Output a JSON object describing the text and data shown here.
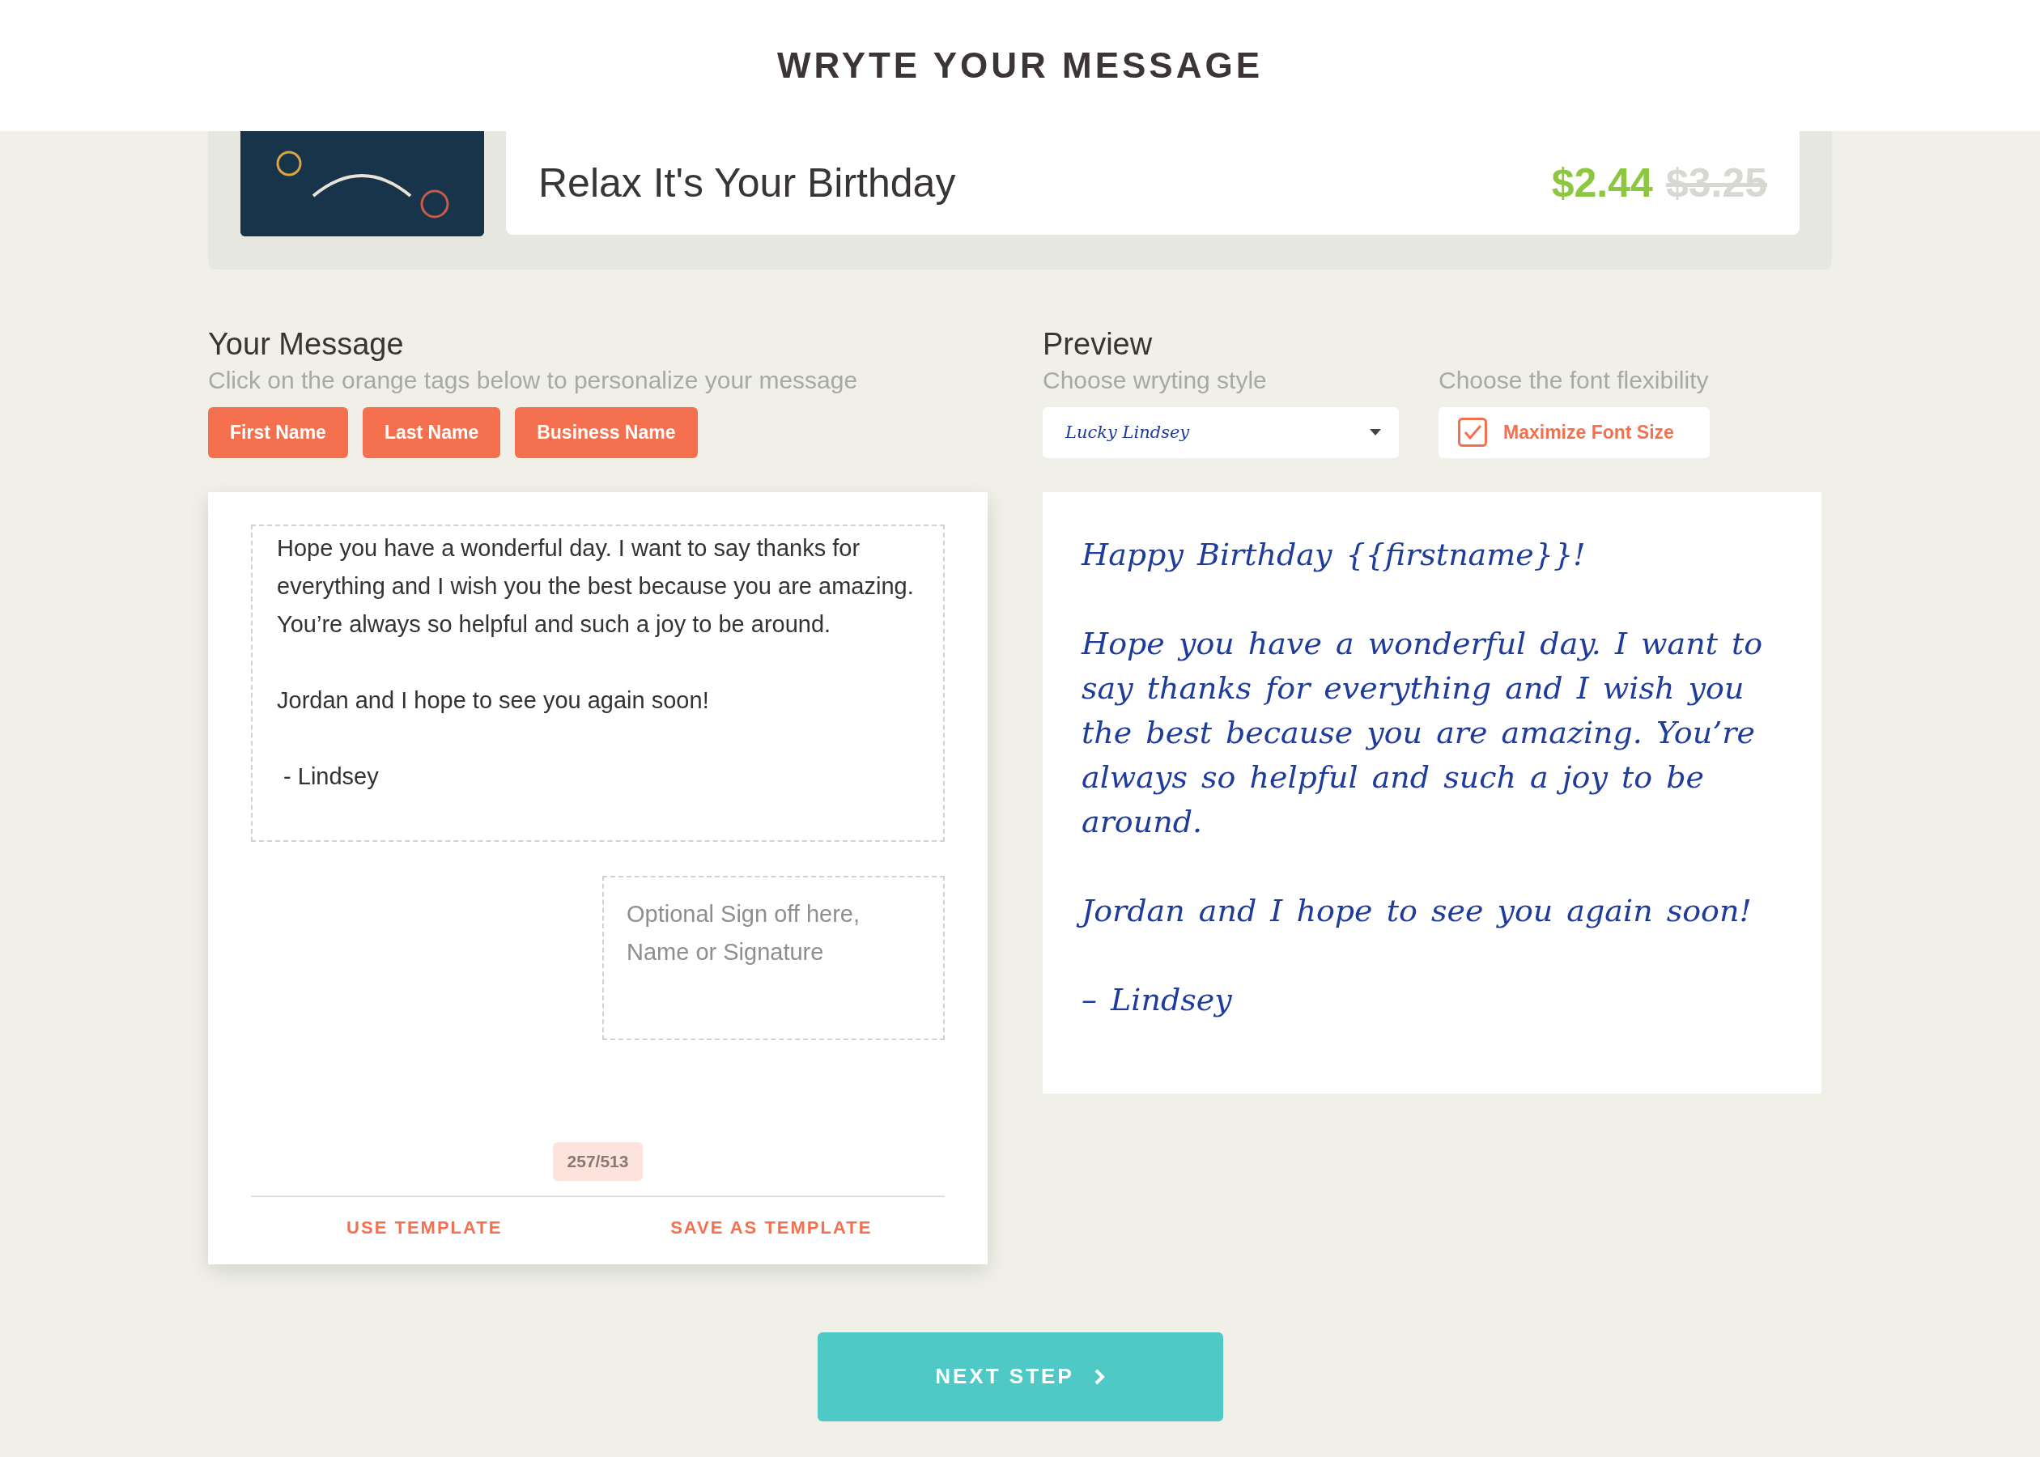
{
  "header": {
    "title": "WRYTE YOUR MESSAGE"
  },
  "product": {
    "title": "Relax It's Your Birthday",
    "price": "$2.44",
    "old_price": "$3.25"
  },
  "message": {
    "heading": "Your Message",
    "hint": "Click on the orange tags below to personalize your message",
    "tags": [
      "First Name",
      "Last Name",
      "Business Name"
    ],
    "value": "Hope you have a wonderful day. I want to say thanks for everything and I wish you the best because you are amazing. You’re always so helpful and such a joy to be around.\n\nJordan and I hope to see you again soon!\n\n - Lindsey",
    "signoff": {
      "placeholder": "Optional Sign off here, Name or Signature"
    },
    "counter": "257/513",
    "actions": [
      "USE TEMPLATE",
      "SAVE AS TEMPLATE"
    ]
  },
  "preview": {
    "heading": "Preview",
    "style_label": "Choose wryting style",
    "style_value": "Lucky Lindsey",
    "flex_label": "Choose the font flexibility",
    "maximize": {
      "label": "Maximize Font Size",
      "checked": true
    },
    "paragraphs": [
      "Happy Birthday {{firstname}}!",
      "Hope you have a wonderful day. I want to say thanks for everything and I wish you the best because you are amazing. You’re always so helpful and such a joy to be around.",
      "Jordan and I hope to see you again soon!",
      " – Lindsey"
    ]
  },
  "next_button": "NEXT STEP"
}
